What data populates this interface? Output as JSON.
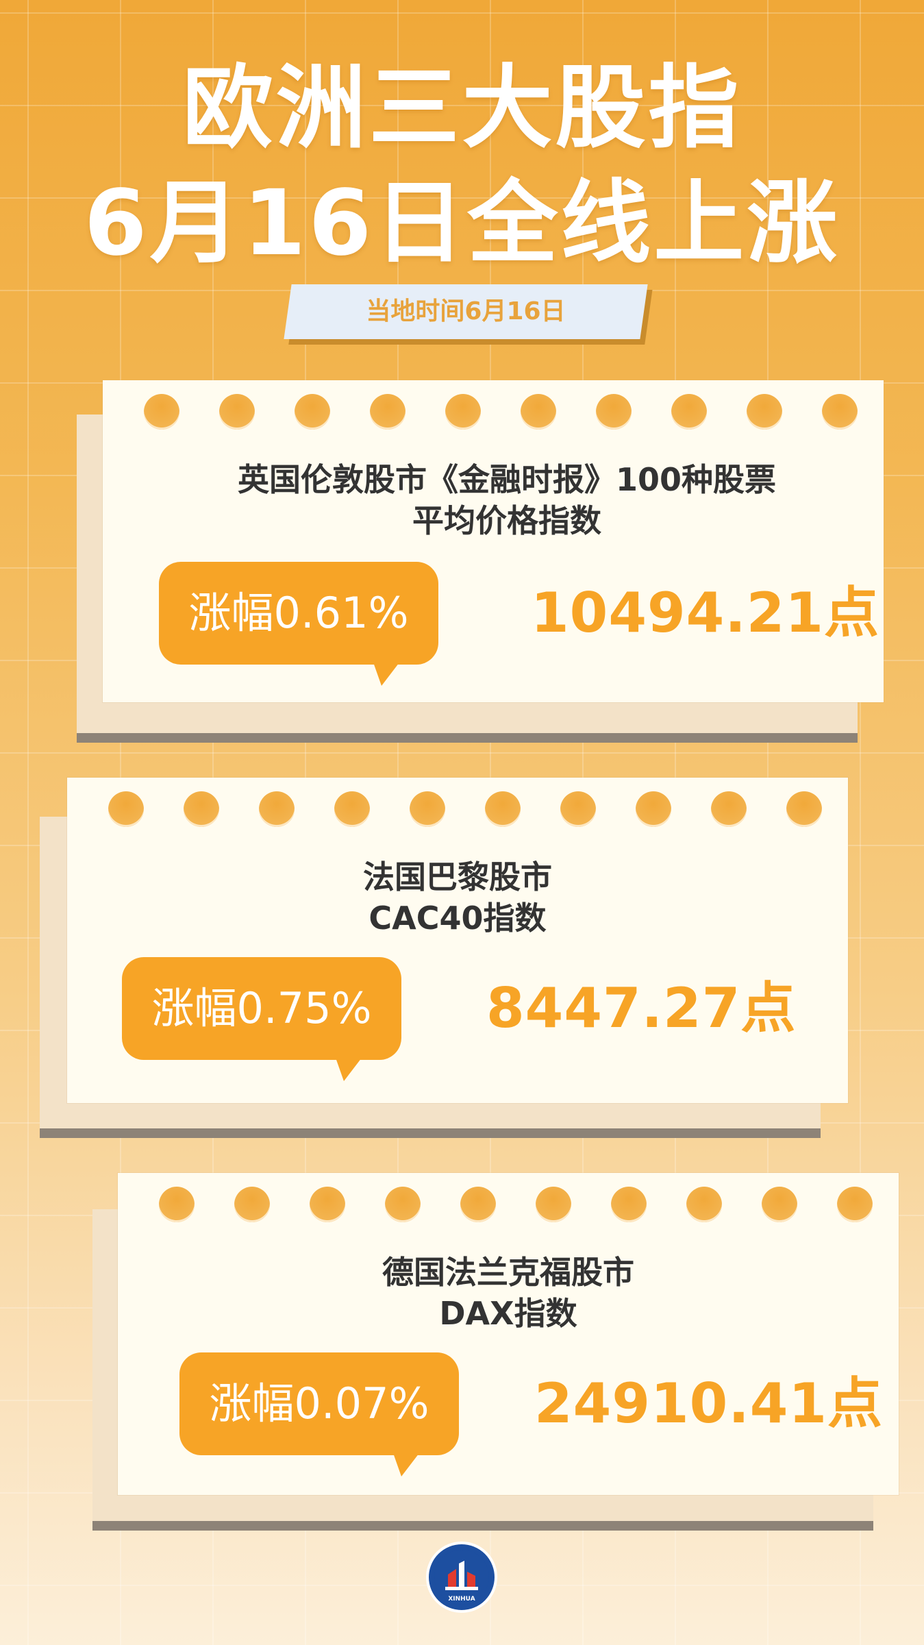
{
  "header": {
    "title_line1": "欧洲三大股指",
    "title_line2": "6月16日全线上涨",
    "date_note": "当地时间6月16日"
  },
  "indices": [
    {
      "name_line1": "英国伦敦股市《金融时报》100种股票",
      "name_line2": "平均价格指数",
      "change": "涨幅0.61%",
      "value": "10494.21点"
    },
    {
      "name_line1": "法国巴黎股市",
      "name_line2": "CAC40指数",
      "change": "涨幅0.75%",
      "value": "8447.27点"
    },
    {
      "name_line1": "德国法兰克福股市",
      "name_line2": "DAX指数",
      "change": "涨幅0.07%",
      "value": "24910.41点"
    }
  ],
  "footer": {
    "logo_icon": "xinhua-logo-icon",
    "logo_text": "XINHUA"
  },
  "colors": {
    "accent": "#f7a426",
    "title_text": "#ffffff",
    "card_bg": "#fffcf0",
    "heading_text": "#333333"
  }
}
